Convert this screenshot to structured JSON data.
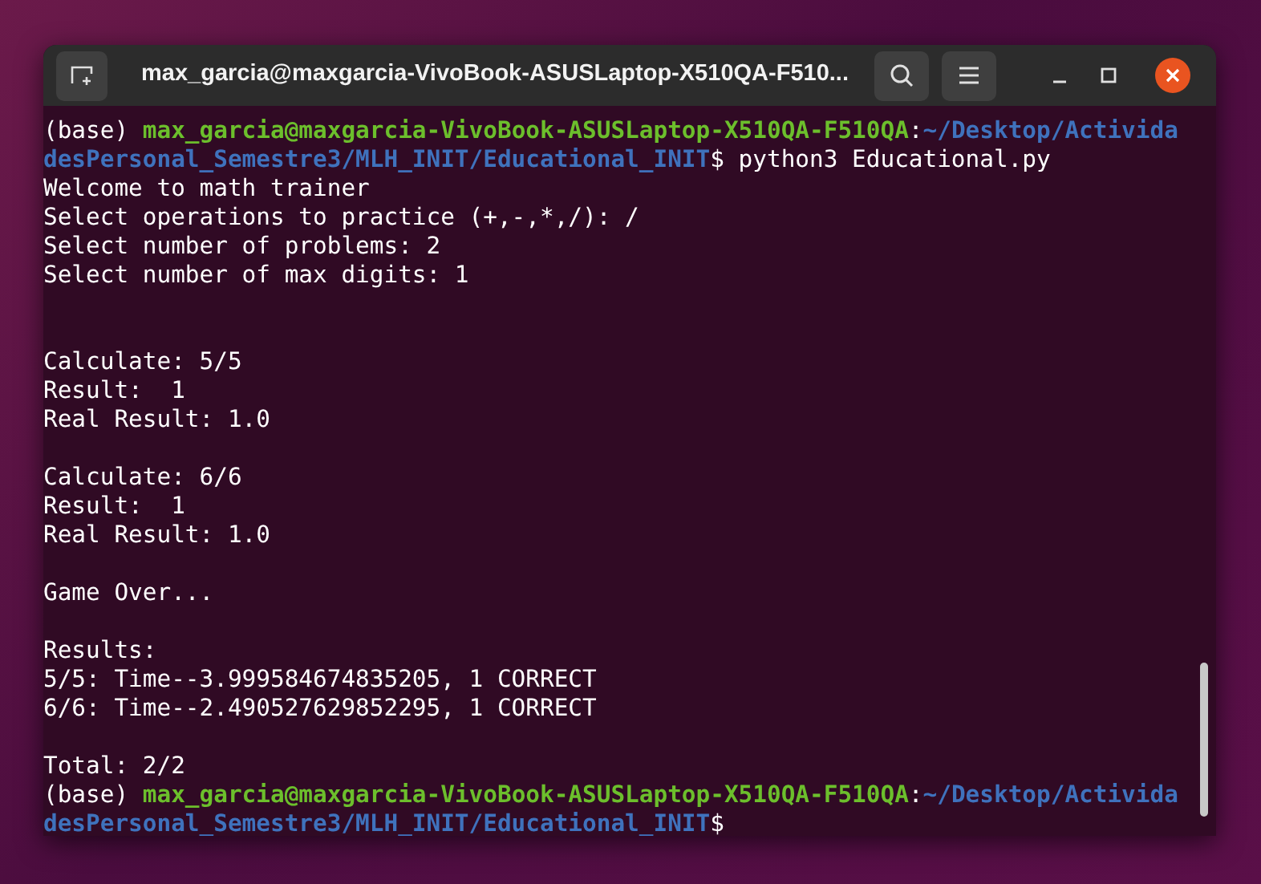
{
  "window": {
    "title": "max_garcia@maxgarcia-VivoBook-ASUSLaptop-X510QA-F510..."
  },
  "terminal": {
    "lines": [
      {
        "kind": "text",
        "segments": [
          {
            "kind": "plain",
            "text": "(base) "
          },
          {
            "kind": "user",
            "text": "max_garcia@maxgarcia-VivoBook-ASUSLaptop-X510QA-F510QA"
          },
          {
            "kind": "plain",
            "text": ":"
          },
          {
            "kind": "path",
            "text": "~/Desktop/Activida"
          }
        ]
      },
      {
        "kind": "text",
        "segments": [
          {
            "kind": "path",
            "text": "desPersonal_Semestre3/MLH_INIT/Educational_INIT"
          },
          {
            "kind": "plain",
            "text": "$ python3 Educational.py"
          }
        ]
      },
      {
        "kind": "text",
        "segments": [
          {
            "kind": "plain",
            "text": "Welcome to math trainer"
          }
        ]
      },
      {
        "kind": "text",
        "segments": [
          {
            "kind": "plain",
            "text": "Select operations to practice (+,-,*,/): /"
          }
        ]
      },
      {
        "kind": "text",
        "segments": [
          {
            "kind": "plain",
            "text": "Select number of problems: 2"
          }
        ]
      },
      {
        "kind": "text",
        "segments": [
          {
            "kind": "plain",
            "text": "Select number of max digits: 1"
          }
        ]
      },
      {
        "kind": "blank"
      },
      {
        "kind": "blank"
      },
      {
        "kind": "text",
        "segments": [
          {
            "kind": "plain",
            "text": "Calculate: 5/5"
          }
        ]
      },
      {
        "kind": "text",
        "segments": [
          {
            "kind": "plain",
            "text": "Result:  1"
          }
        ]
      },
      {
        "kind": "text",
        "segments": [
          {
            "kind": "plain",
            "text": "Real Result: 1.0"
          }
        ]
      },
      {
        "kind": "blank"
      },
      {
        "kind": "text",
        "segments": [
          {
            "kind": "plain",
            "text": "Calculate: 6/6"
          }
        ]
      },
      {
        "kind": "text",
        "segments": [
          {
            "kind": "plain",
            "text": "Result:  1"
          }
        ]
      },
      {
        "kind": "text",
        "segments": [
          {
            "kind": "plain",
            "text": "Real Result: 1.0"
          }
        ]
      },
      {
        "kind": "blank"
      },
      {
        "kind": "text",
        "segments": [
          {
            "kind": "plain",
            "text": "Game Over..."
          }
        ]
      },
      {
        "kind": "blank"
      },
      {
        "kind": "text",
        "segments": [
          {
            "kind": "plain",
            "text": "Results:"
          }
        ]
      },
      {
        "kind": "text",
        "segments": [
          {
            "kind": "plain",
            "text": "5/5: Time--3.999584674835205, 1 CORRECT"
          }
        ]
      },
      {
        "kind": "text",
        "segments": [
          {
            "kind": "plain",
            "text": "6/6: Time--2.490527629852295, 1 CORRECT"
          }
        ]
      },
      {
        "kind": "blank"
      },
      {
        "kind": "text",
        "segments": [
          {
            "kind": "plain",
            "text": "Total: 2/2"
          }
        ]
      },
      {
        "kind": "text",
        "segments": [
          {
            "kind": "plain",
            "text": "(base) "
          },
          {
            "kind": "user",
            "text": "max_garcia@maxgarcia-VivoBook-ASUSLaptop-X510QA-F510QA"
          },
          {
            "kind": "plain",
            "text": ":"
          },
          {
            "kind": "path",
            "text": "~/Desktop/Activida"
          }
        ]
      },
      {
        "kind": "text",
        "segments": [
          {
            "kind": "path",
            "text": "desPersonal_Semestre3/MLH_INIT/Educational_INIT"
          },
          {
            "kind": "plain",
            "text": "$"
          }
        ]
      }
    ]
  }
}
